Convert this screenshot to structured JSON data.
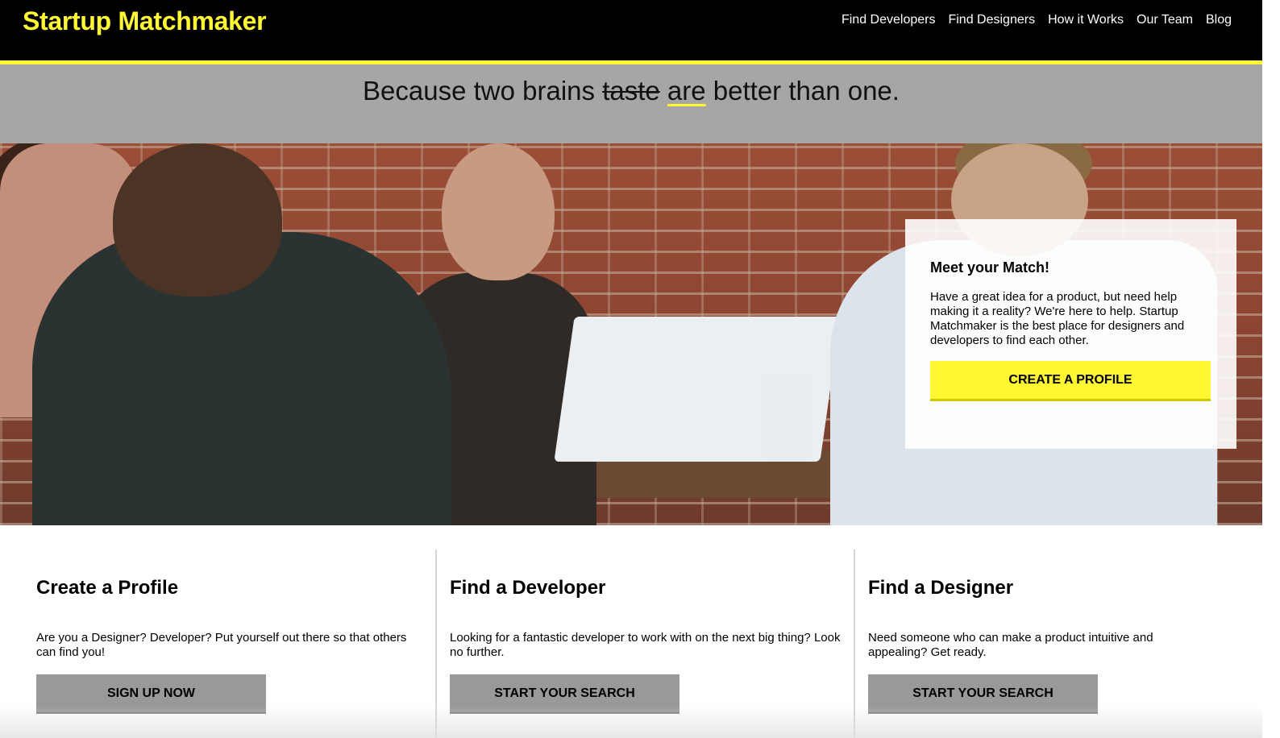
{
  "brand": {
    "name": "Startup Matchmaker",
    "color": "#fff833"
  },
  "nav": {
    "items": [
      "Find Developers",
      "Find Designers",
      "How it Works",
      "Our Team",
      "Blog"
    ]
  },
  "tagline": {
    "prefix": "Because two brains",
    "struck_word": "taste",
    "underlined_word": "are",
    "suffix": "better than one."
  },
  "hero": {
    "image_description_icon": "hero-photo",
    "card": {
      "title": "Meet your Match!",
      "body": "Have a great idea for a product, but need help making it a reality? We're here to help. Startup Matchmaker is the best place for designers and developers to find each other.",
      "button_label": "CREATE A PROFILE"
    }
  },
  "features": [
    {
      "title": "Create a Profile",
      "body": "Are you a Designer? Developer? Put yourself out there so that others can find you!",
      "button_label": "SIGN UP NOW"
    },
    {
      "title": "Find a Developer",
      "body": "Looking for a fantastic developer to work with on the next big thing? Look no further.",
      "button_label": "START YOUR SEARCH"
    },
    {
      "title": "Find a Designer",
      "body": "Need someone who can make a product intuitive and appealing? Get ready.",
      "button_label": "START YOUR SEARCH"
    }
  ],
  "colors": {
    "header_bg": "#000000",
    "accent": "#fff833",
    "tagline_bg": "#a6a6a6",
    "button_gray": "#999999"
  }
}
